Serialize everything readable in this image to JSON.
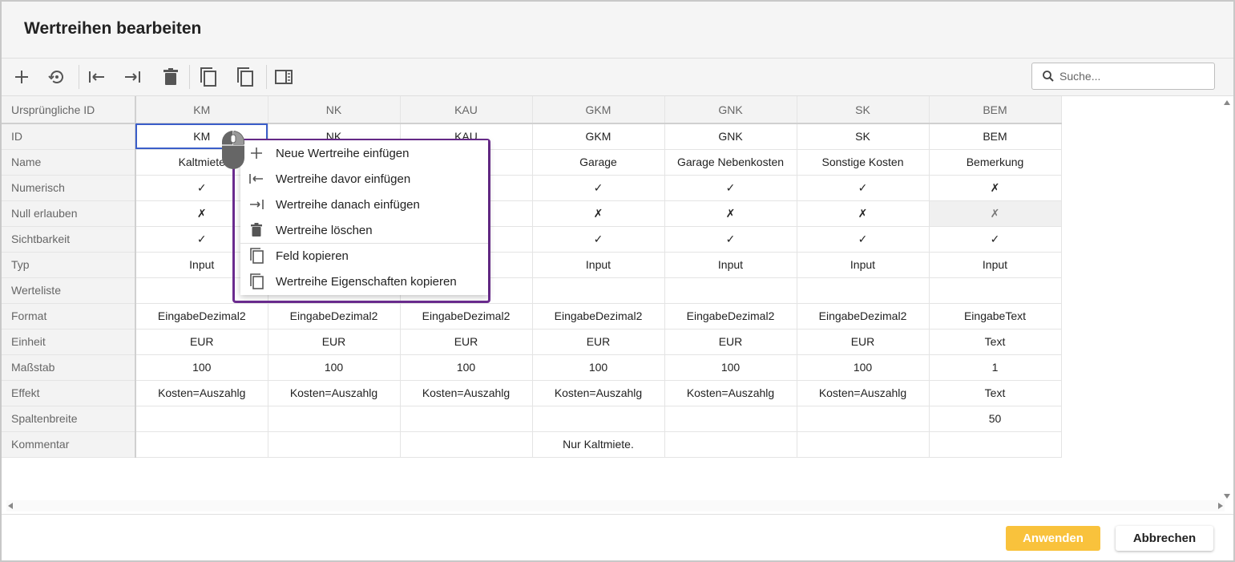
{
  "dialog": {
    "title": "Wertreihen bearbeiten"
  },
  "toolbar": {
    "search_placeholder": "Suche...",
    "icons": [
      "plus-icon",
      "history-icon",
      "insert-before-icon",
      "insert-after-icon",
      "trash-icon",
      "copy-icon",
      "copy-properties-icon",
      "panel-icon"
    ]
  },
  "grid": {
    "header_label": "Ursprüngliche ID",
    "columns": [
      "KM",
      "NK",
      "KAU",
      "GKM",
      "GNK",
      "SK",
      "BEM"
    ],
    "rows": [
      {
        "label": "ID",
        "cells": [
          "KM",
          "NK",
          "KAU",
          "GKM",
          "GNK",
          "SK",
          "BEM"
        ]
      },
      {
        "label": "Name",
        "cells": [
          "Kaltmiete",
          "",
          "",
          "Garage",
          "Garage Nebenkosten",
          "Sonstige Kosten",
          "Bemerkung"
        ]
      },
      {
        "label": "Numerisch",
        "cells": [
          "✓",
          "",
          "",
          "✓",
          "✓",
          "✓",
          "✗"
        ]
      },
      {
        "label": "Null erlauben",
        "cells": [
          "✗",
          "",
          "",
          "✗",
          "✗",
          "✗",
          "✗"
        ]
      },
      {
        "label": "Sichtbarkeit",
        "cells": [
          "✓",
          "",
          "",
          "✓",
          "✓",
          "✓",
          "✓"
        ]
      },
      {
        "label": "Typ",
        "cells": [
          "Input",
          "",
          "",
          "Input",
          "Input",
          "Input",
          "Input"
        ]
      },
      {
        "label": "Werteliste",
        "cells": [
          "",
          "",
          "",
          "",
          "",
          "",
          ""
        ]
      },
      {
        "label": "Format",
        "cells": [
          "EingabeDezimal2",
          "EingabeDezimal2",
          "EingabeDezimal2",
          "EingabeDezimal2",
          "EingabeDezimal2",
          "EingabeDezimal2",
          "EingabeText"
        ]
      },
      {
        "label": "Einheit",
        "cells": [
          "EUR",
          "EUR",
          "EUR",
          "EUR",
          "EUR",
          "EUR",
          "Text"
        ]
      },
      {
        "label": "Maßstab",
        "cells": [
          "100",
          "100",
          "100",
          "100",
          "100",
          "100",
          "1"
        ]
      },
      {
        "label": "Effekt",
        "cells": [
          "Kosten=Auszahlg",
          "Kosten=Auszahlg",
          "Kosten=Auszahlg",
          "Kosten=Auszahlg",
          "Kosten=Auszahlg",
          "Kosten=Auszahlg",
          "Text"
        ]
      },
      {
        "label": "Spaltenbreite",
        "cells": [
          "",
          "",
          "",
          "",
          "",
          "",
          "50"
        ]
      },
      {
        "label": "Kommentar",
        "cells": [
          "",
          "",
          "",
          "Nur Kaltmiete.",
          "",
          "",
          ""
        ]
      }
    ]
  },
  "context_menu": {
    "items": [
      {
        "label": "Neue Wertreihe einfügen",
        "icon": "plus-icon"
      },
      {
        "label": "Wertreihe davor einfügen",
        "icon": "insert-before-icon"
      },
      {
        "label": "Wertreihe danach einfügen",
        "icon": "insert-after-icon"
      },
      {
        "label": "Wertreihe löschen",
        "icon": "trash-icon"
      },
      {
        "label": "Feld kopieren",
        "icon": "copy-icon"
      },
      {
        "label": "Wertreihe Eigenschaften kopieren",
        "icon": "copy-properties-icon"
      }
    ]
  },
  "footer": {
    "apply_label": "Anwenden",
    "cancel_label": "Abbrechen"
  },
  "colors": {
    "accent": "#f9c23c",
    "menu_highlight_frame": "#6b2c8f",
    "selection": "#3b5ec9"
  }
}
